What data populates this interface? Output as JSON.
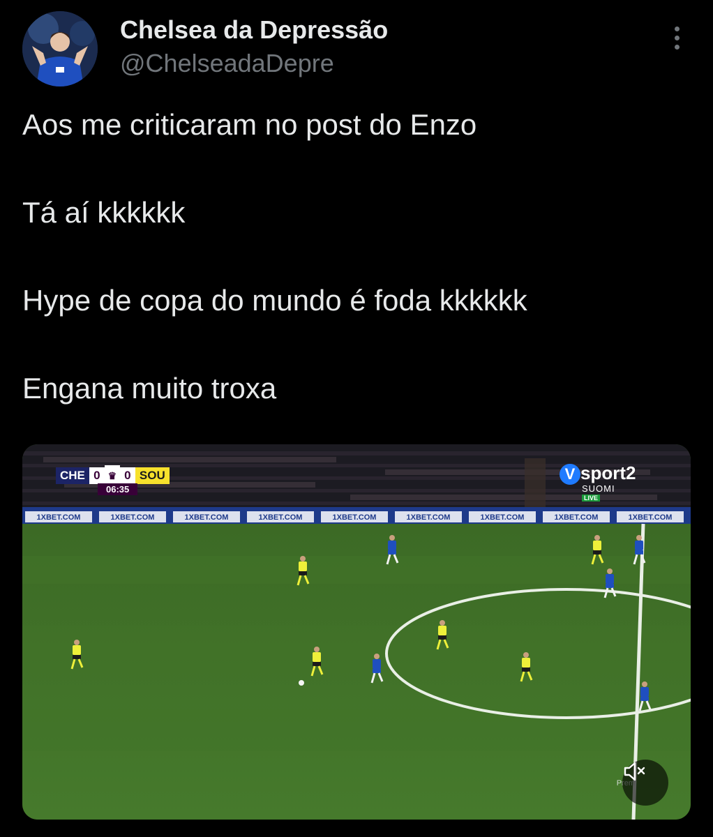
{
  "author": {
    "name": "Chelsea da Depressão",
    "handle": "@ChelseadaDepre"
  },
  "tweet": {
    "lines": [
      "Aos me criticaram no post do Enzo",
      "Tá aí kkkkkk",
      "Hype de copa do mundo é foda kkkkkk",
      "Engana muito troxa"
    ]
  },
  "media": {
    "scoreboard": {
      "home": "CHE",
      "home_score": "0",
      "away_score": "0",
      "away": "SOU",
      "clock": "06:35"
    },
    "broadcaster": {
      "logo_letter": "V",
      "name": "sport2",
      "region": "SUOMI",
      "live_badge": "LIVE"
    },
    "ad_boards": [
      "1XBET.COM",
      "1XBET.COM",
      "1XBET.COM",
      "1XBET.COM",
      "1XBET.COM",
      "1XBET.COM",
      "1XBET.COM",
      "1XBET.COM",
      "1XBET.COM"
    ],
    "watermark": "Prem",
    "icons": {
      "mute": "speaker-muted-icon",
      "more": "more-vertical-icon"
    }
  },
  "colors": {
    "background": "#000000",
    "text": "#e7e9ea",
    "secondary": "#71767b",
    "pitch": "#3f6b27",
    "home_kit": "#1f4fbf",
    "away_kit": "#eef03a"
  }
}
